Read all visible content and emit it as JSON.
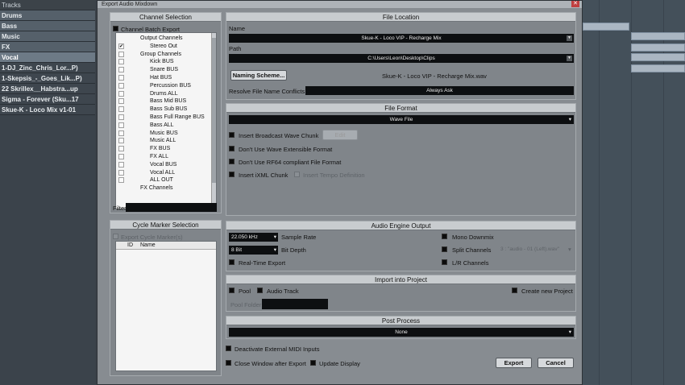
{
  "daw": {
    "tracks": [
      {
        "name": "Tracks",
        "kind": "tracks"
      },
      {
        "name": "Drums",
        "kind": "group"
      },
      {
        "name": "Bass",
        "kind": "group"
      },
      {
        "name": "Music",
        "kind": "group"
      },
      {
        "name": "FX",
        "kind": "group"
      },
      {
        "name": "Vocal",
        "kind": "sel"
      },
      {
        "name": "1-DJ_Zinc_Chris_Lor...P)",
        "kind": "audio"
      },
      {
        "name": "1-Skepsis_-_Goes_Lik...P)",
        "kind": "audio"
      },
      {
        "name": "22 Skrillex__Habstra...up",
        "kind": "audio"
      },
      {
        "name": "Sigma - Forever (Sku...17",
        "kind": "audio"
      },
      {
        "name": "Skue-K - Loco Mix v1-01",
        "kind": "audio"
      }
    ]
  },
  "dialog": {
    "title": "Export Audio Mixdown",
    "close_glyph": "✕"
  },
  "channel_selection": {
    "title": "Channel Selection",
    "batch_export_label": "Channel Batch Export",
    "tree": [
      {
        "label": "Output Channels",
        "level": 0,
        "checkbox": false
      },
      {
        "label": "Stereo Out",
        "level": 1,
        "checkbox": true,
        "checked": true
      },
      {
        "label": "Group Channels",
        "level": 0,
        "checkbox": true
      },
      {
        "label": "Kick BUS",
        "level": 1,
        "checkbox": true
      },
      {
        "label": "Snare BUS",
        "level": 1,
        "checkbox": true
      },
      {
        "label": "Hat BUS",
        "level": 1,
        "checkbox": true
      },
      {
        "label": "Percussion BUS",
        "level": 1,
        "checkbox": true
      },
      {
        "label": "Drums ALL",
        "level": 1,
        "checkbox": true
      },
      {
        "label": "Bass Mid BUS",
        "level": 1,
        "checkbox": true
      },
      {
        "label": "Bass Sub BUS",
        "level": 1,
        "checkbox": true
      },
      {
        "label": "Bass Full Range BUS",
        "level": 1,
        "checkbox": true
      },
      {
        "label": "Bass ALL",
        "level": 1,
        "checkbox": true
      },
      {
        "label": "Music BUS",
        "level": 1,
        "checkbox": true
      },
      {
        "label": "Music ALL",
        "level": 1,
        "checkbox": true
      },
      {
        "label": "FX BUS",
        "level": 1,
        "checkbox": true
      },
      {
        "label": "FX ALL",
        "level": 1,
        "checkbox": true
      },
      {
        "label": "Vocal BUS",
        "level": 1,
        "checkbox": true
      },
      {
        "label": "Vocal ALL",
        "level": 1,
        "checkbox": true
      },
      {
        "label": "ALL OUT",
        "level": 1,
        "checkbox": true
      },
      {
        "label": "FX Channels",
        "level": 0,
        "checkbox": false
      }
    ],
    "filter_label": "Filter",
    "filter_value": ""
  },
  "cycle_marker": {
    "title": "Cycle Marker Selection",
    "export_label": "Export Cycle Marker(s)",
    "col_id": "ID",
    "col_name": "Name"
  },
  "file_location": {
    "title": "File Location",
    "name_label": "Name",
    "name_value": "Skue-K - Loco VIP - Recharge Mix",
    "path_label": "Path",
    "path_value": "C:\\Users\\Leon\\Desktop\\Clips",
    "naming_button": "Naming Scheme...",
    "filename_preview": "Skue-K - Loco VIP - Recharge Mix.wav",
    "resolve_label": "Resolve File Name Conflicts",
    "resolve_value": "Always Ask"
  },
  "file_format": {
    "title": "File Format",
    "format_value": "Wave File",
    "broadcast_label": "Insert Broadcast Wave Chunk",
    "edit_button": "Edit",
    "no_wave_ext_label": "Don't Use Wave Extensible Format",
    "no_rf64_label": "Don't Use RF64 compliant File Format",
    "ixml_label": "Insert iXML Chunk",
    "tempo_label": "Insert Tempo Definition"
  },
  "audio_engine": {
    "title": "Audio Engine Output",
    "sample_rate_value": "22.050 kHz",
    "sample_rate_label": "Sample Rate",
    "bit_depth_value": "8 Bit",
    "bit_depth_label": "Bit Depth",
    "realtime_label": "Real-Time Export",
    "mono_label": "Mono Downmix",
    "split_label": "Split Channels",
    "split_preview": "3 : \"audio - 01 (Left).wav\"",
    "lr_label": "L/R Channels"
  },
  "import_project": {
    "title": "Import into Project",
    "pool_label": "Pool",
    "audio_track_label": "Audio Track",
    "new_project_label": "Create new Project",
    "pool_folder_label": "Pool Folder",
    "pool_folder_value": ""
  },
  "post_process": {
    "title": "Post Process",
    "value": "None"
  },
  "footer": {
    "deactivate_midi_label": "Deactivate External MIDI Inputs",
    "close_window_label": "Close Window after Export",
    "update_display_label": "Update Display",
    "export_button": "Export",
    "cancel_button": "Cancel"
  }
}
